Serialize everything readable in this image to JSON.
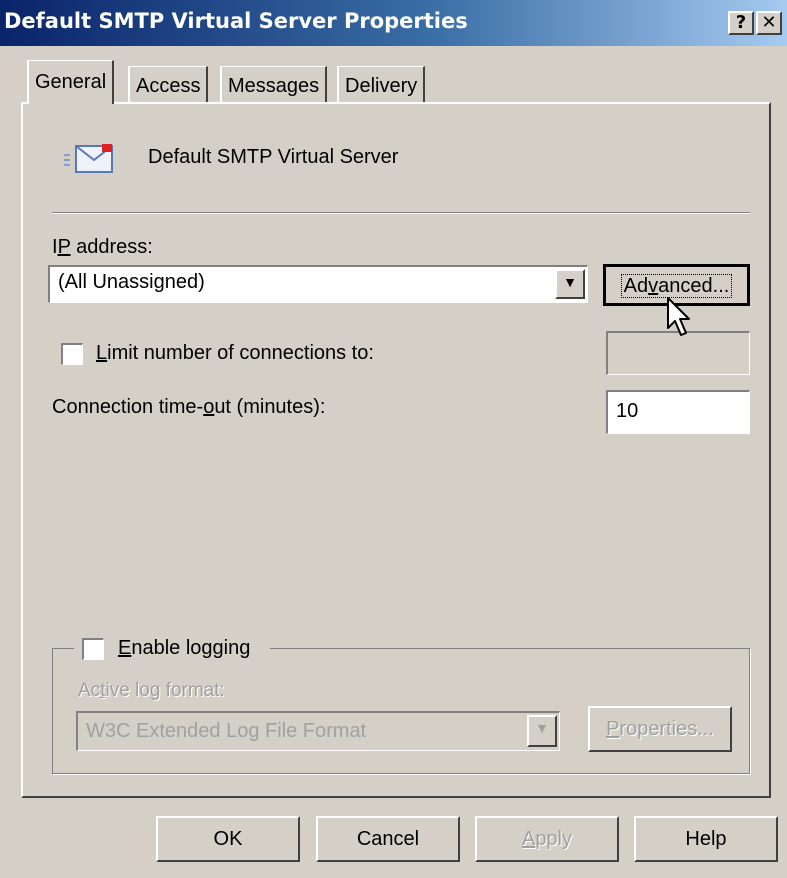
{
  "window": {
    "title": "Default SMTP Virtual Server Properties",
    "help_button": "?",
    "close_button": "✕"
  },
  "tabs": [
    {
      "label": "General",
      "active": true
    },
    {
      "label": "Access",
      "active": false
    },
    {
      "label": "Messages",
      "active": false
    },
    {
      "label": "Delivery",
      "active": false
    }
  ],
  "general": {
    "server_name": "Default SMTP Virtual Server",
    "server_icon": "mail-envelope-icon",
    "ip_address_label_pre": "I",
    "ip_address_label_mnemonic": "P",
    "ip_address_label_post": " address:",
    "ip_address_value": "(All Unassigned)",
    "advanced_pre": "Ad",
    "advanced_mnemonic": "v",
    "advanced_post": "anced...",
    "limit_connections_mnemonic": "L",
    "limit_connections_post": "imit number of connections to:",
    "limit_connections_checked": false,
    "limit_connections_value": "",
    "timeout_label_pre": "Connection time-",
    "timeout_label_mnemonic": "o",
    "timeout_label_post": "ut (minutes):",
    "timeout_value": "10",
    "logging_mnemonic": "E",
    "logging_post": "nable logging",
    "logging_checked": false,
    "log_format_pre": "Ac",
    "log_format_mnemonic": "t",
    "log_format_post": "ive log format:",
    "log_format_value": "W3C Extended Log File Format",
    "properties_mnemonic": "P",
    "properties_post": "roperties..."
  },
  "footer": {
    "ok": "OK",
    "cancel": "Cancel",
    "apply_mnemonic": "A",
    "apply_post": "pply",
    "help": "Help"
  }
}
